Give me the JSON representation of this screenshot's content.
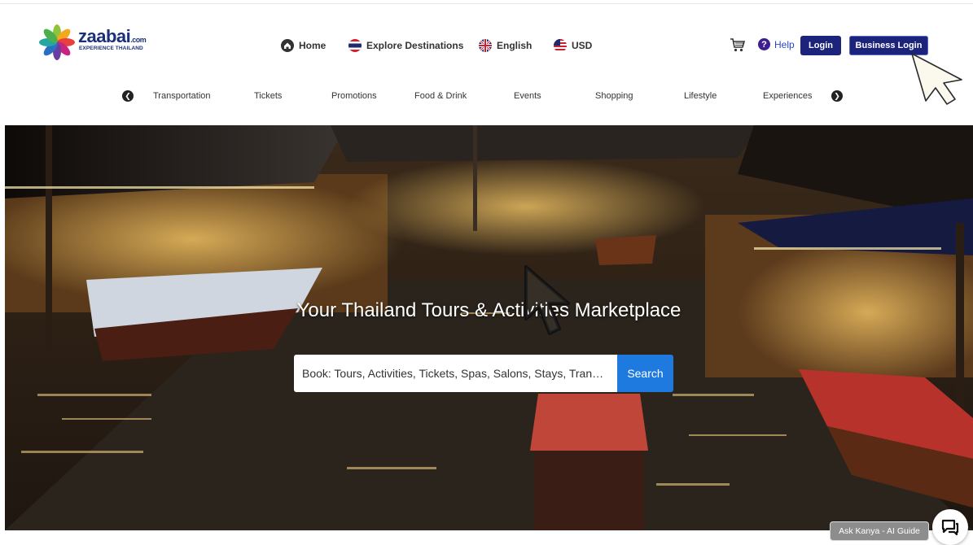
{
  "logo": {
    "brand": "zaabai",
    "suffix": ".com",
    "tagline": "EXPERIENCE THAILAND"
  },
  "nav": [
    {
      "label": "Home",
      "icon": "home-icon"
    },
    {
      "label": "Explore Destinations",
      "icon": "thailand-flag-icon"
    },
    {
      "label": "English",
      "icon": "uk-flag-icon"
    },
    {
      "label": "USD",
      "icon": "us-flag-icon"
    }
  ],
  "header_right": {
    "cart_icon": "cart-icon",
    "help_label": "Help",
    "login_label": "Login",
    "business_login_label": "Business Login"
  },
  "categories": [
    "Transportation",
    "Tickets",
    "Promotions",
    "Food & Drink",
    "Events",
    "Shopping",
    "Lifestyle",
    "Experiences"
  ],
  "hero": {
    "title": "Your Thailand Tours & Activities Marketplace",
    "search_value": "Book: Tours, Activities, Tickets, Spas, Salons, Stays, Tran…",
    "search_button": "Search"
  },
  "chat": {
    "ask_label": "Ask Kanya - AI Guide",
    "icon": "chat-icon"
  },
  "colors": {
    "brand_navy": "#1b237a",
    "search_blue": "#1f7ae0",
    "help_blue": "#2347c9"
  }
}
